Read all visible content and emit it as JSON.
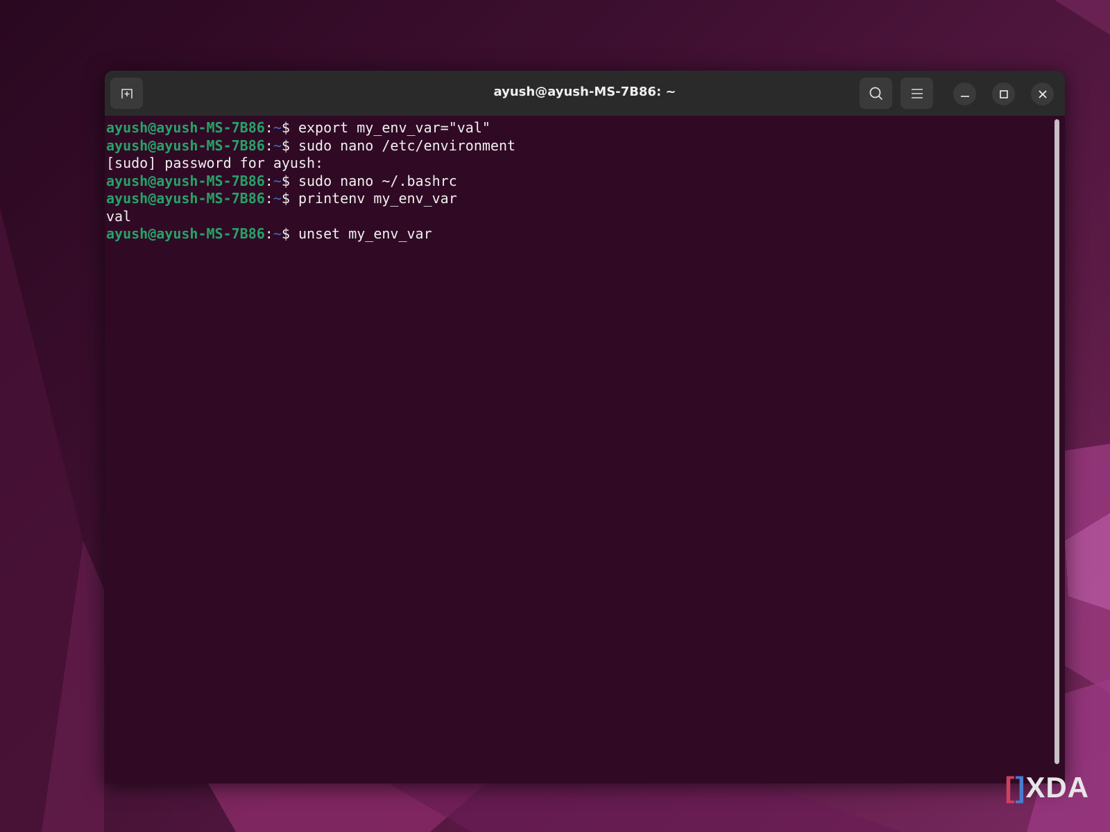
{
  "window": {
    "title": "ayush@ayush-MS-7B86: ~"
  },
  "terminal": {
    "lines": [
      {
        "user": "ayush@ayush-MS-7B86",
        "sep": ":",
        "path": "~",
        "prompt": "$ ",
        "cmd": "export my_env_var=\"val\""
      },
      {
        "user": "ayush@ayush-MS-7B86",
        "sep": ":",
        "path": "~",
        "prompt": "$ ",
        "cmd": "sudo nano /etc/environment"
      },
      {
        "output": "[sudo] password for ayush:"
      },
      {
        "user": "ayush@ayush-MS-7B86",
        "sep": ":",
        "path": "~",
        "prompt": "$ ",
        "cmd": "sudo nano ~/.bashrc"
      },
      {
        "user": "ayush@ayush-MS-7B86",
        "sep": ":",
        "path": "~",
        "prompt": "$ ",
        "cmd": "printenv my_env_var"
      },
      {
        "output": "val"
      },
      {
        "user": "ayush@ayush-MS-7B86",
        "sep": ":",
        "path": "~",
        "prompt": "$ ",
        "cmd": "unset my_env_var"
      }
    ]
  },
  "watermark": "XDA",
  "colors": {
    "prompt_user": "#26a269",
    "prompt_path": "#3a6fc4",
    "terminal_bg": "#300a24"
  }
}
